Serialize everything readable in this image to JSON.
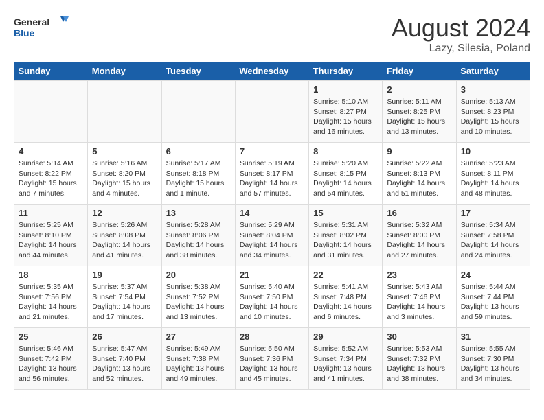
{
  "logo": {
    "line1": "General",
    "line2": "Blue"
  },
  "title": "August 2024",
  "subtitle": "Lazy, Silesia, Poland",
  "days_of_week": [
    "Sunday",
    "Monday",
    "Tuesday",
    "Wednesday",
    "Thursday",
    "Friday",
    "Saturday"
  ],
  "weeks": [
    [
      {
        "day": "",
        "info": ""
      },
      {
        "day": "",
        "info": ""
      },
      {
        "day": "",
        "info": ""
      },
      {
        "day": "",
        "info": ""
      },
      {
        "day": "1",
        "info": "Sunrise: 5:10 AM\nSunset: 8:27 PM\nDaylight: 15 hours\nand 16 minutes."
      },
      {
        "day": "2",
        "info": "Sunrise: 5:11 AM\nSunset: 8:25 PM\nDaylight: 15 hours\nand 13 minutes."
      },
      {
        "day": "3",
        "info": "Sunrise: 5:13 AM\nSunset: 8:23 PM\nDaylight: 15 hours\nand 10 minutes."
      }
    ],
    [
      {
        "day": "4",
        "info": "Sunrise: 5:14 AM\nSunset: 8:22 PM\nDaylight: 15 hours\nand 7 minutes."
      },
      {
        "day": "5",
        "info": "Sunrise: 5:16 AM\nSunset: 8:20 PM\nDaylight: 15 hours\nand 4 minutes."
      },
      {
        "day": "6",
        "info": "Sunrise: 5:17 AM\nSunset: 8:18 PM\nDaylight: 15 hours\nand 1 minute."
      },
      {
        "day": "7",
        "info": "Sunrise: 5:19 AM\nSunset: 8:17 PM\nDaylight: 14 hours\nand 57 minutes."
      },
      {
        "day": "8",
        "info": "Sunrise: 5:20 AM\nSunset: 8:15 PM\nDaylight: 14 hours\nand 54 minutes."
      },
      {
        "day": "9",
        "info": "Sunrise: 5:22 AM\nSunset: 8:13 PM\nDaylight: 14 hours\nand 51 minutes."
      },
      {
        "day": "10",
        "info": "Sunrise: 5:23 AM\nSunset: 8:11 PM\nDaylight: 14 hours\nand 48 minutes."
      }
    ],
    [
      {
        "day": "11",
        "info": "Sunrise: 5:25 AM\nSunset: 8:10 PM\nDaylight: 14 hours\nand 44 minutes."
      },
      {
        "day": "12",
        "info": "Sunrise: 5:26 AM\nSunset: 8:08 PM\nDaylight: 14 hours\nand 41 minutes."
      },
      {
        "day": "13",
        "info": "Sunrise: 5:28 AM\nSunset: 8:06 PM\nDaylight: 14 hours\nand 38 minutes."
      },
      {
        "day": "14",
        "info": "Sunrise: 5:29 AM\nSunset: 8:04 PM\nDaylight: 14 hours\nand 34 minutes."
      },
      {
        "day": "15",
        "info": "Sunrise: 5:31 AM\nSunset: 8:02 PM\nDaylight: 14 hours\nand 31 minutes."
      },
      {
        "day": "16",
        "info": "Sunrise: 5:32 AM\nSunset: 8:00 PM\nDaylight: 14 hours\nand 27 minutes."
      },
      {
        "day": "17",
        "info": "Sunrise: 5:34 AM\nSunset: 7:58 PM\nDaylight: 14 hours\nand 24 minutes."
      }
    ],
    [
      {
        "day": "18",
        "info": "Sunrise: 5:35 AM\nSunset: 7:56 PM\nDaylight: 14 hours\nand 21 minutes."
      },
      {
        "day": "19",
        "info": "Sunrise: 5:37 AM\nSunset: 7:54 PM\nDaylight: 14 hours\nand 17 minutes."
      },
      {
        "day": "20",
        "info": "Sunrise: 5:38 AM\nSunset: 7:52 PM\nDaylight: 14 hours\nand 13 minutes."
      },
      {
        "day": "21",
        "info": "Sunrise: 5:40 AM\nSunset: 7:50 PM\nDaylight: 14 hours\nand 10 minutes."
      },
      {
        "day": "22",
        "info": "Sunrise: 5:41 AM\nSunset: 7:48 PM\nDaylight: 14 hours\nand 6 minutes."
      },
      {
        "day": "23",
        "info": "Sunrise: 5:43 AM\nSunset: 7:46 PM\nDaylight: 14 hours\nand 3 minutes."
      },
      {
        "day": "24",
        "info": "Sunrise: 5:44 AM\nSunset: 7:44 PM\nDaylight: 13 hours\nand 59 minutes."
      }
    ],
    [
      {
        "day": "25",
        "info": "Sunrise: 5:46 AM\nSunset: 7:42 PM\nDaylight: 13 hours\nand 56 minutes."
      },
      {
        "day": "26",
        "info": "Sunrise: 5:47 AM\nSunset: 7:40 PM\nDaylight: 13 hours\nand 52 minutes."
      },
      {
        "day": "27",
        "info": "Sunrise: 5:49 AM\nSunset: 7:38 PM\nDaylight: 13 hours\nand 49 minutes."
      },
      {
        "day": "28",
        "info": "Sunrise: 5:50 AM\nSunset: 7:36 PM\nDaylight: 13 hours\nand 45 minutes."
      },
      {
        "day": "29",
        "info": "Sunrise: 5:52 AM\nSunset: 7:34 PM\nDaylight: 13 hours\nand 41 minutes."
      },
      {
        "day": "30",
        "info": "Sunrise: 5:53 AM\nSunset: 7:32 PM\nDaylight: 13 hours\nand 38 minutes."
      },
      {
        "day": "31",
        "info": "Sunrise: 5:55 AM\nSunset: 7:30 PM\nDaylight: 13 hours\nand 34 minutes."
      }
    ]
  ]
}
